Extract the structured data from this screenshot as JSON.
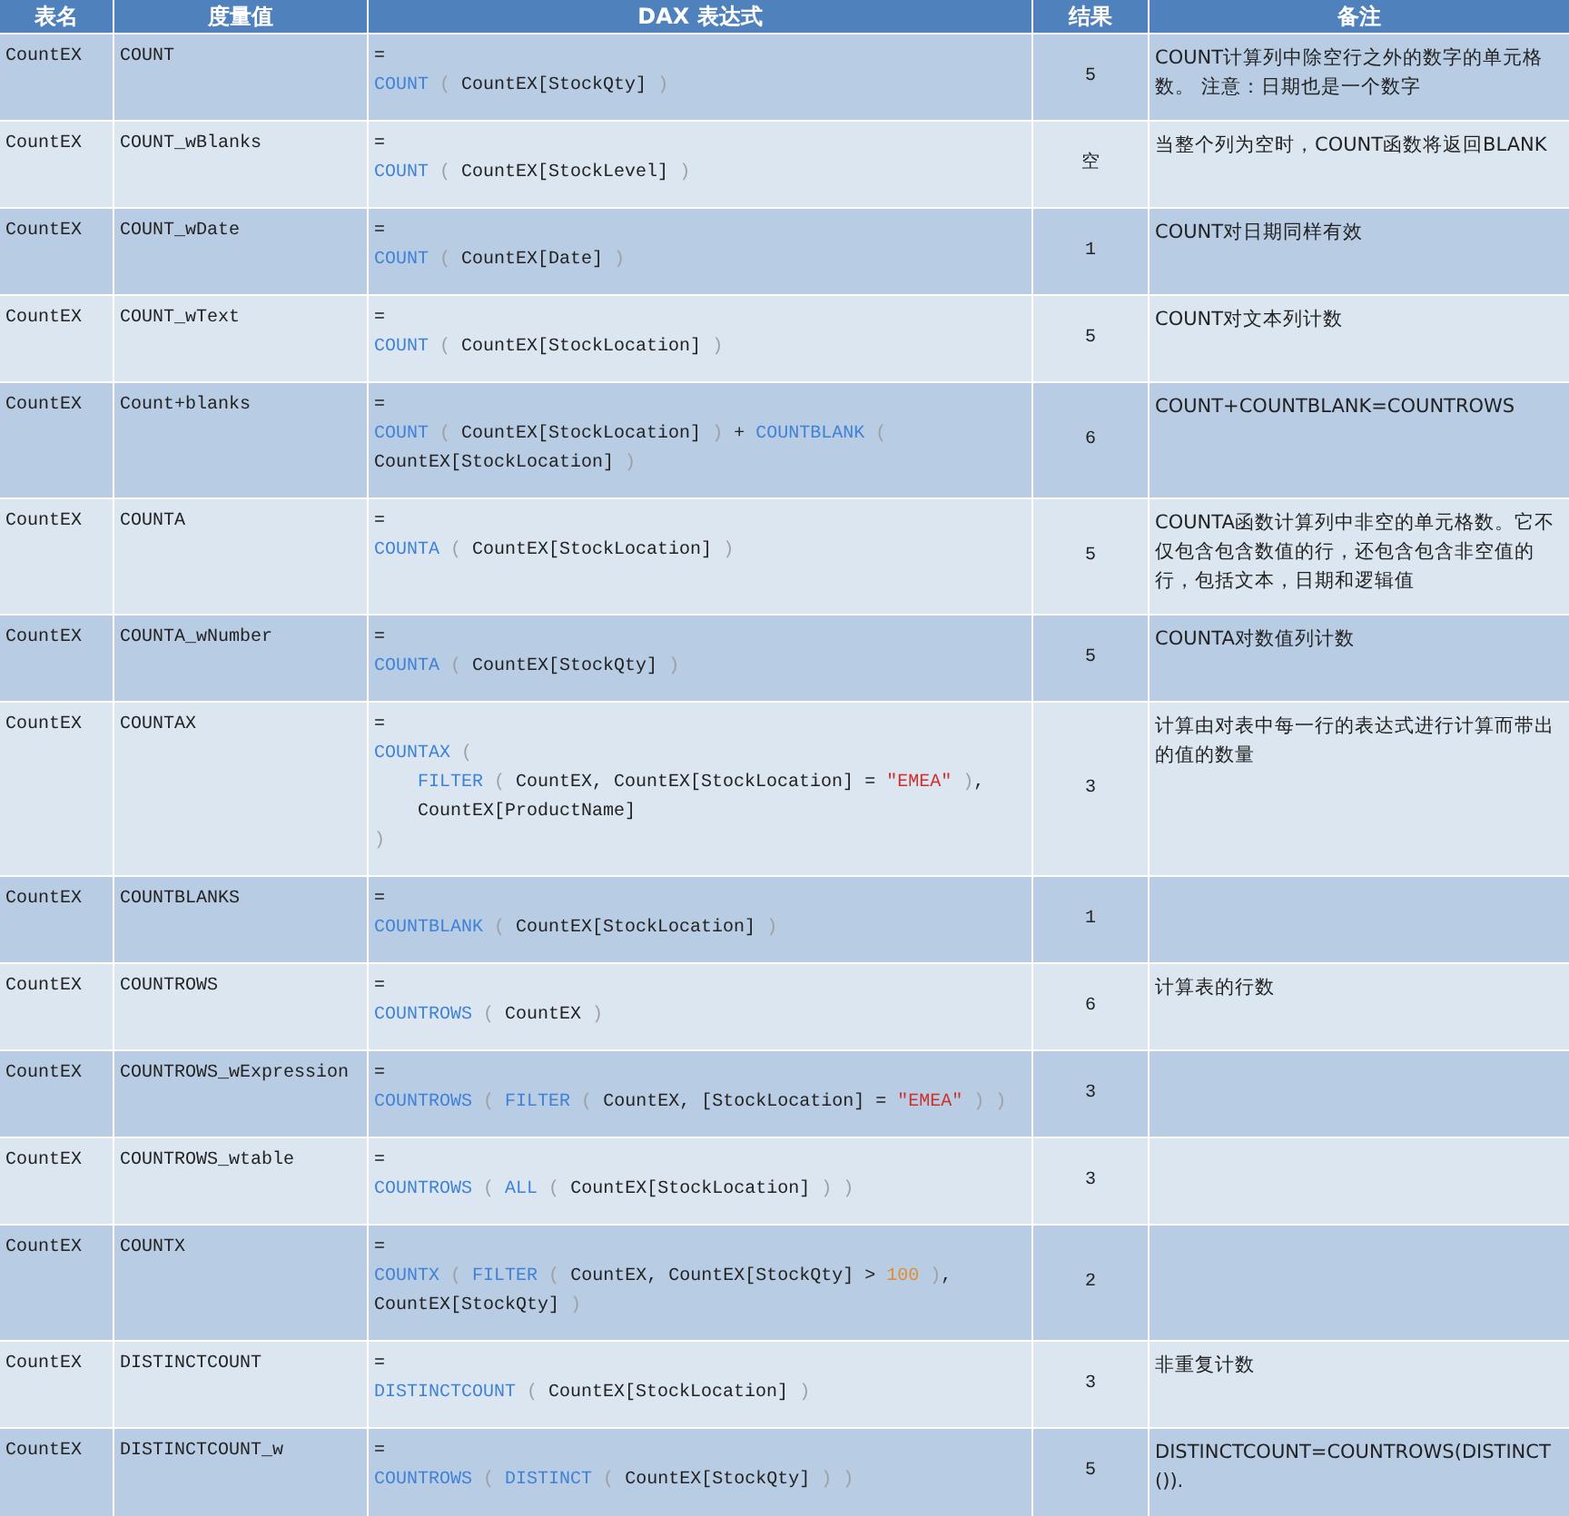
{
  "columns": [
    "表名",
    "度量值",
    "DAX 表达式",
    "结果",
    "备注"
  ],
  "rows": [
    {
      "table": "CountEX",
      "measure": "COUNT",
      "expression": [
        {
          "tokens": [
            {
              "kind": "op",
              "t": "="
            }
          ]
        },
        {
          "tokens": [
            {
              "kind": "fn",
              "t": "COUNT"
            },
            {
              "kind": "paren",
              "t": " ( "
            },
            {
              "kind": "text",
              "t": "CountEX[StockQty]"
            },
            {
              "kind": "paren",
              "t": " )"
            }
          ]
        }
      ],
      "result": "5",
      "note": "COUNT计算列中除空行之外的数字的单元格数。 注意：日期也是一个数字"
    },
    {
      "table": "CountEX",
      "measure": "COUNT_wBlanks",
      "expression": [
        {
          "tokens": [
            {
              "kind": "op",
              "t": "="
            }
          ]
        },
        {
          "tokens": [
            {
              "kind": "fn",
              "t": "COUNT"
            },
            {
              "kind": "paren",
              "t": " ( "
            },
            {
              "kind": "text",
              "t": "CountEX[StockLevel]"
            },
            {
              "kind": "paren",
              "t": " )"
            }
          ]
        }
      ],
      "result": "空",
      "note": "当整个列为空时，COUNT函数将返回BLANK"
    },
    {
      "table": "CountEX",
      "measure": "COUNT_wDate",
      "expression": [
        {
          "tokens": [
            {
              "kind": "op",
              "t": "="
            }
          ]
        },
        {
          "tokens": [
            {
              "kind": "fn",
              "t": "COUNT"
            },
            {
              "kind": "paren",
              "t": " ( "
            },
            {
              "kind": "text",
              "t": "CountEX[Date]"
            },
            {
              "kind": "paren",
              "t": " )"
            }
          ]
        }
      ],
      "result": "1",
      "note": "COUNT对日期同样有效"
    },
    {
      "table": "CountEX",
      "measure": "COUNT_wText",
      "expression": [
        {
          "tokens": [
            {
              "kind": "op",
              "t": "="
            }
          ]
        },
        {
          "tokens": [
            {
              "kind": "fn",
              "t": "COUNT"
            },
            {
              "kind": "paren",
              "t": " ( "
            },
            {
              "kind": "text",
              "t": "CountEX[StockLocation]"
            },
            {
              "kind": "paren",
              "t": " )"
            }
          ]
        }
      ],
      "result": "5",
      "note": "COUNT对文本列计数"
    },
    {
      "table": "CountEX",
      "measure": "Count+blanks",
      "expression": [
        {
          "tokens": [
            {
              "kind": "op",
              "t": "="
            }
          ]
        },
        {
          "tokens": [
            {
              "kind": "fn",
              "t": "COUNT"
            },
            {
              "kind": "paren",
              "t": " ( "
            },
            {
              "kind": "text",
              "t": "CountEX[StockLocation]"
            },
            {
              "kind": "paren",
              "t": " ) "
            },
            {
              "kind": "text",
              "t": "+ "
            },
            {
              "kind": "fn",
              "t": "COUNTBLANK"
            },
            {
              "kind": "paren",
              "t": " ("
            }
          ]
        },
        {
          "tokens": [
            {
              "kind": "text",
              "t": "CountEX[StockLocation]"
            },
            {
              "kind": "paren",
              "t": " )"
            }
          ]
        }
      ],
      "result": "6",
      "note": "COUNT+COUNTBLANK=COUNTROWS"
    },
    {
      "table": "CountEX",
      "measure": "COUNTA",
      "expression": [
        {
          "tokens": [
            {
              "kind": "op",
              "t": "="
            }
          ]
        },
        {
          "tokens": [
            {
              "kind": "fn",
              "t": "COUNTA"
            },
            {
              "kind": "paren",
              "t": " ( "
            },
            {
              "kind": "text",
              "t": "CountEX[StockLocation]"
            },
            {
              "kind": "paren",
              "t": " )"
            }
          ]
        }
      ],
      "result": "5",
      "note": "COUNTA函数计算列中非空的单元格数。它不仅包含包含数值的行，还包含包含非空值的行，包括文本，日期和逻辑值"
    },
    {
      "table": "CountEX",
      "measure": "COUNTA_wNumber",
      "expression": [
        {
          "tokens": [
            {
              "kind": "op",
              "t": "="
            }
          ]
        },
        {
          "tokens": [
            {
              "kind": "fn",
              "t": "COUNTA"
            },
            {
              "kind": "paren",
              "t": " ( "
            },
            {
              "kind": "text",
              "t": "CountEX[StockQty]"
            },
            {
              "kind": "paren",
              "t": " )"
            }
          ]
        }
      ],
      "result": "5",
      "note": "COUNTA对数值列计数"
    },
    {
      "table": "CountEX",
      "measure": "COUNTAX",
      "expression": [
        {
          "tokens": [
            {
              "kind": "op",
              "t": "="
            }
          ]
        },
        {
          "tokens": [
            {
              "kind": "fn",
              "t": "COUNTAX"
            },
            {
              "kind": "paren",
              "t": " ("
            }
          ]
        },
        {
          "tokens": [
            {
              "kind": "fn",
              "t": "    FILTER"
            },
            {
              "kind": "paren",
              "t": " ( "
            },
            {
              "kind": "text",
              "t": "CountEX, CountEX[StockLocation] = "
            },
            {
              "kind": "str",
              "t": "\"EMEA\""
            },
            {
              "kind": "paren",
              "t": " )"
            },
            {
              "kind": "text",
              "t": ","
            }
          ]
        },
        {
          "tokens": [
            {
              "kind": "text",
              "t": "    CountEX[ProductName]"
            }
          ]
        },
        {
          "tokens": [
            {
              "kind": "paren",
              "t": ")"
            }
          ]
        }
      ],
      "result": "3",
      "note": "计算由对表中每一行的表达式进行计算而带出的值的数量"
    },
    {
      "table": "CountEX",
      "measure": "COUNTBLANKS",
      "expression": [
        {
          "tokens": [
            {
              "kind": "op",
              "t": "="
            }
          ]
        },
        {
          "tokens": [
            {
              "kind": "fn",
              "t": "COUNTBLANK"
            },
            {
              "kind": "paren",
              "t": " ( "
            },
            {
              "kind": "text",
              "t": "CountEX[StockLocation]"
            },
            {
              "kind": "paren",
              "t": " )"
            }
          ]
        }
      ],
      "result": "1"
    },
    {
      "table": "CountEX",
      "measure": "COUNTROWS",
      "expression": [
        {
          "tokens": [
            {
              "kind": "op",
              "t": "="
            }
          ]
        },
        {
          "tokens": [
            {
              "kind": "fn",
              "t": "COUNTROWS"
            },
            {
              "kind": "paren",
              "t": " ( "
            },
            {
              "kind": "text",
              "t": "CountEX"
            },
            {
              "kind": "paren",
              "t": " )"
            }
          ]
        }
      ],
      "result": "6",
      "note": "计算表的行数"
    },
    {
      "table": "CountEX",
      "measure": "COUNTROWS_wExpression",
      "expression": [
        {
          "tokens": [
            {
              "kind": "op",
              "t": "="
            }
          ]
        },
        {
          "tokens": [
            {
              "kind": "fn",
              "t": "COUNTROWS"
            },
            {
              "kind": "paren",
              "t": " ( "
            },
            {
              "kind": "fn",
              "t": "FILTER"
            },
            {
              "kind": "paren",
              "t": " ( "
            },
            {
              "kind": "text",
              "t": "CountEX, [StockLocation] = "
            },
            {
              "kind": "str",
              "t": "\"EMEA\""
            },
            {
              "kind": "paren",
              "t": " ) )"
            }
          ]
        }
      ],
      "result": "3"
    },
    {
      "table": "CountEX",
      "measure": "COUNTROWS_wtable",
      "expression": [
        {
          "tokens": [
            {
              "kind": "op",
              "t": "="
            }
          ]
        },
        {
          "tokens": [
            {
              "kind": "fn",
              "t": "COUNTROWS"
            },
            {
              "kind": "paren",
              "t": " ( "
            },
            {
              "kind": "fn",
              "t": "ALL"
            },
            {
              "kind": "paren",
              "t": " ( "
            },
            {
              "kind": "text",
              "t": "CountEX[StockLocation]"
            },
            {
              "kind": "paren",
              "t": " ) )"
            }
          ]
        }
      ],
      "result": "3"
    },
    {
      "table": "CountEX",
      "measure": "COUNTX",
      "expression": [
        {
          "tokens": [
            {
              "kind": "op",
              "t": "="
            }
          ]
        },
        {
          "tokens": [
            {
              "kind": "fn",
              "t": "COUNTX"
            },
            {
              "kind": "paren",
              "t": " ( "
            },
            {
              "kind": "fn",
              "t": "FILTER"
            },
            {
              "kind": "paren",
              "t": " ( "
            },
            {
              "kind": "text",
              "t": "CountEX, CountEX[StockQty] > "
            },
            {
              "kind": "num",
              "t": "100"
            },
            {
              "kind": "paren",
              "t": " )"
            },
            {
              "kind": "text",
              "t": ","
            }
          ]
        },
        {
          "tokens": [
            {
              "kind": "text",
              "t": "CountEX[StockQty]"
            },
            {
              "kind": "paren",
              "t": " )"
            }
          ]
        }
      ],
      "result": "2"
    },
    {
      "table": "CountEX",
      "measure": "DISTINCTCOUNT",
      "expression": [
        {
          "tokens": [
            {
              "kind": "op",
              "t": "="
            }
          ]
        },
        {
          "tokens": [
            {
              "kind": "fn",
              "t": "DISTINCTCOUNT"
            },
            {
              "kind": "paren",
              "t": " ( "
            },
            {
              "kind": "text",
              "t": "CountEX[StockLocation]"
            },
            {
              "kind": "paren",
              "t": " )"
            }
          ]
        }
      ],
      "result": "3",
      "note": "非重复计数"
    },
    {
      "table": "CountEX",
      "measure": "DISTINCTCOUNT_w",
      "expression": [
        {
          "tokens": [
            {
              "kind": "op",
              "t": "="
            }
          ]
        },
        {
          "tokens": [
            {
              "kind": "fn",
              "t": "COUNTROWS"
            },
            {
              "kind": "paren",
              "t": " ( "
            },
            {
              "kind": "fn",
              "t": "DISTINCT"
            },
            {
              "kind": "paren",
              "t": " ( "
            },
            {
              "kind": "text",
              "t": "CountEX[StockQty]"
            },
            {
              "kind": "paren",
              "t": " ) )"
            }
          ]
        }
      ],
      "result": "5",
      "note": "DISTINCTCOUNT=COUNTROWS(DISTINCT())."
    }
  ]
}
